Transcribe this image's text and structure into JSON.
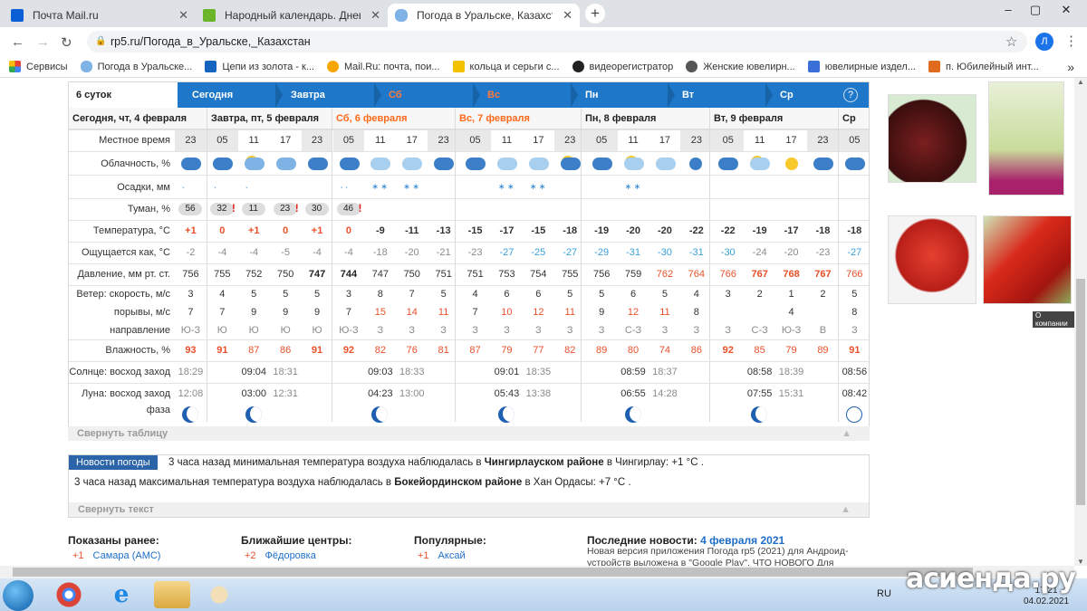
{
  "browser": {
    "tabs": [
      {
        "title": "Почта Mail.ru",
        "active": false
      },
      {
        "title": "Народный календарь. Дневник",
        "active": false
      },
      {
        "title": "Погода в Уральске, Казахстан -",
        "active": true
      }
    ],
    "new_tab": "+",
    "url": "rp5.ru/Погода_в_Уральске,_Казахстан",
    "avatar": "Л",
    "bookmarks": [
      "Сервисы",
      "Погода в Уральске...",
      "Цепи из золота - к...",
      "Mail.Ru: почта, пои...",
      "кольца и серьги с...",
      "видеорегистратор",
      "Женские ювелирн...",
      "ювелирные издел...",
      "п. Юбилейный инт..."
    ],
    "more": "»"
  },
  "weather": {
    "tabs": [
      {
        "label": "6 суток"
      },
      {
        "label": "Сегодня"
      },
      {
        "label": "Завтра"
      },
      {
        "label": "Сб"
      },
      {
        "label": "Вс"
      },
      {
        "label": "Пн"
      },
      {
        "label": "Вт"
      },
      {
        "label": "Ср"
      }
    ],
    "help": "?",
    "day_headers": [
      "Сегодня, чт, 4 февраля",
      "Завтра, пт, 5 февраля",
      "Сб, 6 февраля",
      "Вс, 7 февраля",
      "Пн, 8 февраля",
      "Вт, 9 февраля",
      "Ср"
    ],
    "labels": {
      "time": "Местное время",
      "clouds": "Облачность, %",
      "precip": "Осадки, мм",
      "fog": "Туман, %",
      "temp": "Температура, °C",
      "feels": "Ощущается как, °C",
      "pressure": "Давление, мм рт. ст.",
      "wind": "Ветер: скорость, м/с",
      "gusts": "порывы, м/с",
      "direction": "направление",
      "humidity": "Влажность, %",
      "sun": "Солнце: восход  заход",
      "moon": "Луна: восход  заход",
      "phase": "фаза"
    },
    "times": [
      "23",
      "05",
      "11",
      "17",
      "23",
      "05",
      "11",
      "17",
      "23",
      "05",
      "11",
      "17",
      "23",
      "05",
      "11",
      "17",
      "23",
      "05",
      "11",
      "17",
      "23",
      "05"
    ],
    "fog": [
      "56",
      "32",
      "11",
      "23",
      "30",
      "46"
    ],
    "temp": [
      "+1",
      "0",
      "+1",
      "0",
      "+1",
      "0",
      "-9",
      "-11",
      "-13",
      "-15",
      "-17",
      "-15",
      "-18",
      "-19",
      "-20",
      "-20",
      "-22",
      "-22",
      "-19",
      "-17",
      "-18",
      "-18"
    ],
    "feels": [
      "-2",
      "-4",
      "-4",
      "-5",
      "-4",
      "-4",
      "-18",
      "-20",
      "-21",
      "-23",
      "-27",
      "-25",
      "-27",
      "-29",
      "-31",
      "-30",
      "-31",
      "-30",
      "-24",
      "-20",
      "-23",
      "-27"
    ],
    "pressure": [
      "756",
      "755",
      "752",
      "750",
      "747",
      "744",
      "747",
      "750",
      "751",
      "751",
      "753",
      "754",
      "755",
      "756",
      "759",
      "762",
      "764",
      "766",
      "767",
      "768",
      "767",
      "766"
    ],
    "wind": [
      "3",
      "4",
      "5",
      "5",
      "5",
      "3",
      "8",
      "7",
      "5",
      "4",
      "6",
      "6",
      "5",
      "5",
      "6",
      "5",
      "4",
      "3",
      "2",
      "1",
      "2",
      "5"
    ],
    "gusts": [
      "7",
      "7",
      "9",
      "9",
      "9",
      "7",
      "15",
      "14",
      "11",
      "7",
      "10",
      "12",
      "11",
      "9",
      "12",
      "11",
      "8",
      "",
      "",
      "4",
      "",
      "8"
    ],
    "direction": [
      "Ю-З",
      "Ю",
      "Ю",
      "Ю",
      "Ю",
      "Ю-З",
      "З",
      "З",
      "З",
      "З",
      "З",
      "З",
      "З",
      "З",
      "С-З",
      "З",
      "З",
      "З",
      "С-З",
      "Ю-З",
      "В",
      "З"
    ],
    "humidity": [
      "93",
      "91",
      "87",
      "86",
      "91",
      "92",
      "82",
      "76",
      "81",
      "87",
      "79",
      "77",
      "82",
      "89",
      "80",
      "74",
      "86",
      "92",
      "85",
      "79",
      "89",
      "91"
    ],
    "sun": [
      {
        "rise": "",
        "set": "18:29"
      },
      {
        "rise": "09:04",
        "set": "18:31"
      },
      {
        "rise": "09:03",
        "set": "18:33"
      },
      {
        "rise": "09:01",
        "set": "18:35"
      },
      {
        "rise": "08:59",
        "set": "18:37"
      },
      {
        "rise": "08:58",
        "set": "18:39"
      },
      {
        "rise": "08:56",
        "set": ""
      }
    ],
    "moon": [
      {
        "rise": "",
        "set": "12:08"
      },
      {
        "rise": "03:00",
        "set": "12:31"
      },
      {
        "rise": "04:23",
        "set": "13:00"
      },
      {
        "rise": "05:43",
        "set": "13:38"
      },
      {
        "rise": "06:55",
        "set": "14:28"
      },
      {
        "rise": "07:55",
        "set": "15:31"
      },
      {
        "rise": "08:42",
        "set": ""
      }
    ],
    "collapse_table": "Свернуть таблицу"
  },
  "news": {
    "badge": "Новости погоды",
    "line1_pre": "3 часа назад минимальная температура воздуха наблюдалась в",
    "line1_bold": "Чингирлауском районе",
    "line1_post": "в Чингирлау: +1 °С .",
    "line2_pre": "3 часа назад максимальная температура воздуха наблюдалась в",
    "line2_bold": "Бокейординском районе",
    "line2_post": "в Хан Ордасы: +7 °С .",
    "collapse": "Свернуть текст"
  },
  "footer": {
    "shown": "Показаны ранее:",
    "shown_val": "+1",
    "shown_city": "Самара (АМС)",
    "nearest": "Ближайшие центры:",
    "nearest_val": "+2",
    "nearest_city": "Фёдоровка",
    "popular": "Популярные:",
    "popular_val": "+1",
    "popular_city": "Аксай",
    "latest": "Последние новости:",
    "latest_date": "4 февраля 2021",
    "latest_text1": "Новая версия приложения Погода rp5 (2021) для Андроид-",
    "latest_text2": "устройств выложена в \"Google Play\". ЧТО НОВОГО Для"
  },
  "ads": {
    "company": "О компании"
  },
  "taskbar": {
    "lang": "RU",
    "time": "17:21",
    "date": "04.02.2021"
  },
  "watermark": "асиенда.ру"
}
